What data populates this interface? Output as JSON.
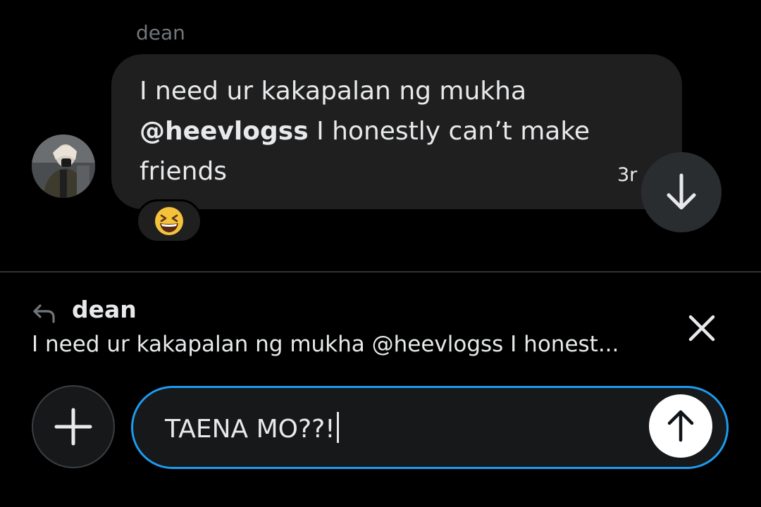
{
  "message": {
    "sender": "dean",
    "line1": "I need ur kakapalan ng mukha",
    "mention": "@heevlogss",
    "line2_rest": " I honestly can’t make",
    "line3": "friends",
    "timestamp": "3r",
    "reaction_emoji": "grinning-squinting-face",
    "reaction_color": "#f5c33b"
  },
  "reply": {
    "name": "dean",
    "preview": "I need ur kakapalan ng mukha @heevlogss I honest..."
  },
  "composer": {
    "value": "TAENA MO??!",
    "border_color": "#1d9bf0"
  },
  "icons": {
    "scroll_down": "arrow-down-icon",
    "reply": "reply-arrow-icon",
    "close": "close-icon",
    "add": "plus-icon",
    "send": "arrow-up-icon"
  }
}
